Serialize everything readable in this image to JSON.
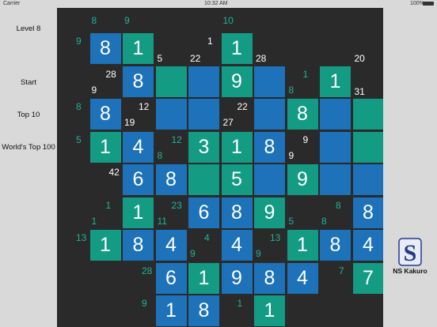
{
  "status_bar": {
    "carrier": "Carrier",
    "time": "10:32 AM",
    "battery": "100%"
  },
  "menu": {
    "level": "Level 8",
    "start": "Start",
    "top10": "Top 10",
    "world_top": "World's Top 100"
  },
  "brand": {
    "name": "NS Kakuro",
    "logo_letter": "S"
  },
  "colors": {
    "blue": "#1d72b9",
    "green": "#139b84",
    "board": "#2a2a2a",
    "clue_teal": "#1fb39a"
  },
  "board": {
    "cells": [
      {
        "r": 0,
        "c": 1,
        "color": "blue",
        "v": "8"
      },
      {
        "r": 0,
        "c": 2,
        "color": "green",
        "v": "1"
      },
      {
        "r": 0,
        "c": 5,
        "color": "green",
        "v": "1"
      },
      {
        "r": 1,
        "c": 2,
        "color": "blue",
        "v": "8"
      },
      {
        "r": 1,
        "c": 3,
        "color": "green",
        "v": ""
      },
      {
        "r": 1,
        "c": 4,
        "color": "blue",
        "v": ""
      },
      {
        "r": 1,
        "c": 5,
        "color": "green",
        "v": "9"
      },
      {
        "r": 1,
        "c": 6,
        "color": "blue",
        "v": ""
      },
      {
        "r": 1,
        "c": 8,
        "color": "green",
        "v": "1"
      },
      {
        "r": 2,
        "c": 1,
        "color": "blue",
        "v": "8"
      },
      {
        "r": 2,
        "c": 3,
        "color": "blue",
        "v": ""
      },
      {
        "r": 2,
        "c": 4,
        "color": "blue",
        "v": ""
      },
      {
        "r": 2,
        "c": 6,
        "color": "blue",
        "v": ""
      },
      {
        "r": 2,
        "c": 7,
        "color": "green",
        "v": "8"
      },
      {
        "r": 2,
        "c": 8,
        "color": "blue",
        "v": ""
      },
      {
        "r": 2,
        "c": 9,
        "color": "green",
        "v": ""
      },
      {
        "r": 3,
        "c": 1,
        "color": "green",
        "v": "1"
      },
      {
        "r": 3,
        "c": 2,
        "color": "blue",
        "v": "4"
      },
      {
        "r": 3,
        "c": 4,
        "color": "green",
        "v": "3"
      },
      {
        "r": 3,
        "c": 5,
        "color": "green",
        "v": "1"
      },
      {
        "r": 3,
        "c": 6,
        "color": "blue",
        "v": "8"
      },
      {
        "r": 3,
        "c": 8,
        "color": "blue",
        "v": ""
      },
      {
        "r": 3,
        "c": 9,
        "color": "green",
        "v": ""
      },
      {
        "r": 4,
        "c": 2,
        "color": "blue",
        "v": "6"
      },
      {
        "r": 4,
        "c": 3,
        "color": "blue",
        "v": "8"
      },
      {
        "r": 4,
        "c": 4,
        "color": "green",
        "v": ""
      },
      {
        "r": 4,
        "c": 5,
        "color": "green",
        "v": "5"
      },
      {
        "r": 4,
        "c": 6,
        "color": "blue",
        "v": ""
      },
      {
        "r": 4,
        "c": 7,
        "color": "green",
        "v": "9"
      },
      {
        "r": 4,
        "c": 8,
        "color": "blue",
        "v": ""
      },
      {
        "r": 4,
        "c": 9,
        "color": "blue",
        "v": ""
      },
      {
        "r": 5,
        "c": 2,
        "color": "green",
        "v": "1"
      },
      {
        "r": 5,
        "c": 4,
        "color": "blue",
        "v": "6"
      },
      {
        "r": 5,
        "c": 5,
        "color": "blue",
        "v": "8"
      },
      {
        "r": 5,
        "c": 6,
        "color": "green",
        "v": "9"
      },
      {
        "r": 5,
        "c": 9,
        "color": "blue",
        "v": "8"
      },
      {
        "r": 6,
        "c": 1,
        "color": "green",
        "v": "1"
      },
      {
        "r": 6,
        "c": 2,
        "color": "blue",
        "v": "8"
      },
      {
        "r": 6,
        "c": 3,
        "color": "blue",
        "v": "4"
      },
      {
        "r": 6,
        "c": 5,
        "color": "blue",
        "v": "4"
      },
      {
        "r": 6,
        "c": 7,
        "color": "green",
        "v": "1"
      },
      {
        "r": 6,
        "c": 8,
        "color": "blue",
        "v": "8"
      },
      {
        "r": 6,
        "c": 9,
        "color": "blue",
        "v": "4"
      },
      {
        "r": 7,
        "c": 3,
        "color": "blue",
        "v": "6"
      },
      {
        "r": 7,
        "c": 4,
        "color": "green",
        "v": "1"
      },
      {
        "r": 7,
        "c": 5,
        "color": "blue",
        "v": "9"
      },
      {
        "r": 7,
        "c": 6,
        "color": "blue",
        "v": "8"
      },
      {
        "r": 7,
        "c": 7,
        "color": "blue",
        "v": "4"
      },
      {
        "r": 7,
        "c": 9,
        "color": "green",
        "v": "7"
      },
      {
        "r": 8,
        "c": 3,
        "color": "blue",
        "v": "1"
      },
      {
        "r": 8,
        "c": 4,
        "color": "blue",
        "v": "8"
      },
      {
        "r": 8,
        "c": 6,
        "color": "green",
        "v": "1"
      }
    ],
    "clues": [
      {
        "r": 0,
        "c": 1,
        "pos": "above",
        "color": "teal",
        "v": "8"
      },
      {
        "r": 0,
        "c": 2,
        "pos": "above",
        "color": "teal",
        "v": "9"
      },
      {
        "r": 0,
        "c": 5,
        "pos": "above",
        "color": "teal",
        "v": "10"
      },
      {
        "r": 0,
        "c": 0,
        "pos": "right",
        "color": "teal",
        "v": "9"
      },
      {
        "r": 0,
        "c": 2,
        "pos": "below",
        "color": "white",
        "v": "5"
      },
      {
        "r": 0,
        "c": 4,
        "pos": "right",
        "color": "white",
        "v": "1"
      },
      {
        "r": 0,
        "c": 3,
        "pos": "below",
        "color": "white",
        "v": "22"
      },
      {
        "r": 0,
        "c": 5,
        "pos": "below",
        "color": "white",
        "v": "28"
      },
      {
        "r": 0,
        "c": 8,
        "pos": "below",
        "color": "white",
        "v": "20"
      },
      {
        "r": 1,
        "c": 1,
        "pos": "topright",
        "color": "white",
        "v": "28"
      },
      {
        "r": 1,
        "c": 1,
        "pos": "bottomleft",
        "color": "white",
        "v": "9"
      },
      {
        "r": 1,
        "c": 7,
        "pos": "topright",
        "color": "teal",
        "v": "1"
      },
      {
        "r": 1,
        "c": 7,
        "pos": "bottomleft",
        "color": "teal",
        "v": "8"
      },
      {
        "r": 1,
        "c": 8,
        "pos": "below",
        "color": "white",
        "v": "31"
      },
      {
        "r": 2,
        "c": 0,
        "pos": "right",
        "color": "teal",
        "v": "8"
      },
      {
        "r": 2,
        "c": 2,
        "pos": "topright",
        "color": "white",
        "v": "12"
      },
      {
        "r": 2,
        "c": 2,
        "pos": "bottomleft",
        "color": "white",
        "v": "19"
      },
      {
        "r": 2,
        "c": 5,
        "pos": "topright",
        "color": "white",
        "v": "22"
      },
      {
        "r": 2,
        "c": 5,
        "pos": "bottomleft",
        "color": "white",
        "v": "27"
      },
      {
        "r": 3,
        "c": 0,
        "pos": "right",
        "color": "teal",
        "v": "5"
      },
      {
        "r": 3,
        "c": 3,
        "pos": "topright",
        "color": "teal",
        "v": "12"
      },
      {
        "r": 3,
        "c": 3,
        "pos": "bottomleft",
        "color": "teal",
        "v": "8"
      },
      {
        "r": 3,
        "c": 7,
        "pos": "topright",
        "color": "white",
        "v": "9"
      },
      {
        "r": 3,
        "c": 7,
        "pos": "bottomleft",
        "color": "white",
        "v": "9"
      },
      {
        "r": 4,
        "c": 1,
        "pos": "right",
        "color": "white",
        "v": "42"
      },
      {
        "r": 5,
        "c": 1,
        "pos": "topright",
        "color": "teal",
        "v": "1"
      },
      {
        "r": 5,
        "c": 1,
        "pos": "bottomleft",
        "color": "teal",
        "v": "1"
      },
      {
        "r": 5,
        "c": 3,
        "pos": "topright",
        "color": "teal",
        "v": "23"
      },
      {
        "r": 5,
        "c": 3,
        "pos": "bottomleft",
        "color": "teal",
        "v": "11"
      },
      {
        "r": 5,
        "c": 7,
        "pos": "bottomleft",
        "color": "teal",
        "v": "5"
      },
      {
        "r": 5,
        "c": 8,
        "pos": "bottomleft",
        "color": "teal",
        "v": "8"
      },
      {
        "r": 5,
        "c": 8,
        "pos": "topright",
        "color": "teal",
        "v": "8"
      },
      {
        "r": 6,
        "c": 0,
        "pos": "right",
        "color": "teal",
        "v": "13"
      },
      {
        "r": 6,
        "c": 4,
        "pos": "topright",
        "color": "teal",
        "v": "4"
      },
      {
        "r": 6,
        "c": 4,
        "pos": "bottomleft",
        "color": "teal",
        "v": "9"
      },
      {
        "r": 6,
        "c": 6,
        "pos": "topright",
        "color": "teal",
        "v": "13"
      },
      {
        "r": 6,
        "c": 6,
        "pos": "bottomleft",
        "color": "teal",
        "v": "9"
      },
      {
        "r": 7,
        "c": 2,
        "pos": "right",
        "color": "teal",
        "v": "28"
      },
      {
        "r": 7,
        "c": 8,
        "pos": "right",
        "color": "teal",
        "v": "7"
      },
      {
        "r": 8,
        "c": 2,
        "pos": "right",
        "color": "teal",
        "v": "9"
      },
      {
        "r": 8,
        "c": 5,
        "pos": "topright",
        "color": "teal",
        "v": "1"
      }
    ]
  }
}
